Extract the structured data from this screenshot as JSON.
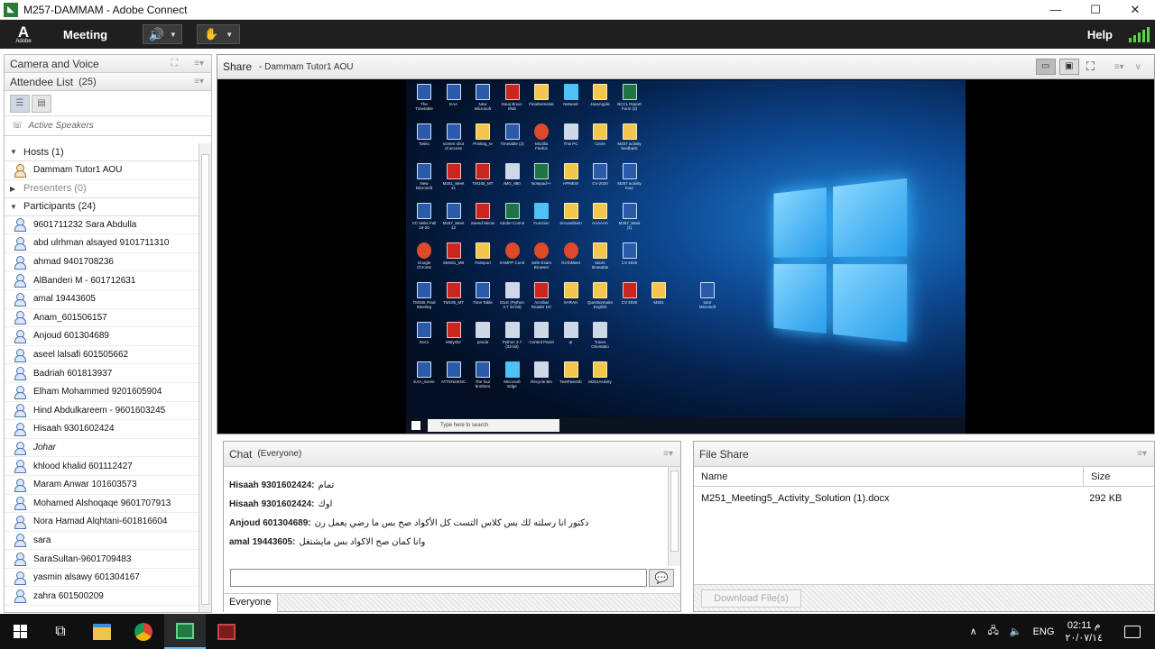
{
  "window": {
    "title": "M257-DAMMAM - Adobe Connect",
    "min": "—",
    "max": "☐",
    "close": "✕"
  },
  "menubar": {
    "meeting": "Meeting",
    "help": "Help"
  },
  "camera_pod": {
    "title": "Camera and Voice"
  },
  "attendee_pod": {
    "title": "Attendee List",
    "count": "(25)",
    "active_speakers": "Active Speakers",
    "hosts_label": "Hosts (1)",
    "hosts": [
      "Dammam Tutor1 AOU"
    ],
    "presenters_label": "Presenters (0)",
    "participants_label": "Participants (24)",
    "participants": [
      "9601711232 Sara Abdulla",
      "abd ulrhman alsayed 9101711310",
      "ahmad 9401708236",
      "AlBanderi M - 601712631",
      "amal  19443605",
      "Anam_601506157",
      "Anjoud 601304689",
      "aseel lalsafi 601505662",
      "Badriah 601813937",
      "Elham Mohammed 9201605904",
      "Hind Abdulkareem - 9601603245",
      "Hisaah 9301602424",
      "Johar",
      "khlood khalid 601112427",
      "Maram Anwar 101603573",
      "Mohamed Alshoqaqe 9601707913",
      "Nora Hamad Alqhtani-601816604",
      "sara",
      "SaraSultan-9601709483",
      "yasmin alsawy 601304167",
      "zahra 601500209"
    ]
  },
  "share_pod": {
    "title": "Share",
    "subtitle": "- Dammam Tutor1 AOU"
  },
  "desktop": {
    "search_placeholder": "Type here to search",
    "icons": [
      "The Timetable",
      "EAA",
      "New Microsoft",
      "Sauq Bnoo-Mob",
      "FinalSemeste",
      "Network",
      "JavaApplic",
      "BCCL Report Form (2)",
      "Tasks",
      "screen shot of access",
      "Printing_re",
      "Timetable (2)",
      "Mozilla Firefox",
      "This PC",
      "Circle",
      "M257 activity feedback",
      "New Microsoft",
      "M251_Meet 11",
      "TM105_MT",
      "IMG_980",
      "Notepad++",
      "HPNEW",
      "CV-2020",
      "M257 activity hour",
      "VC tasks Fall 19-20",
      "M257_Meet 12",
      "Saeed Meow",
      "Adobe Conne",
      "Function",
      "SecondSem",
      "AAAAAA",
      "M257_Meet (1)",
      "Google Chrome",
      "SM161_M8",
      "Passport",
      "XAMPP Contr",
      "Safe Exam Browser",
      "GoToMeet",
      "tutors timetable",
      "CV-2020",
      "TM155 Final Meeting",
      "TM105_MT",
      "Time Table",
      "IDLE (Python 3.7 32-bit)",
      "Acrobat Reader DC",
      "SARAH",
      "Questionnaire English",
      "CV-2020",
      "M251",
      "tutor Microsoft",
      "Doc1",
      "Malyshe",
      "panda",
      "Python 3.7 (32-bit)",
      "Control Panel",
      "qr",
      "Tutors Orientatio",
      "EAA_Scree",
      "ATTENDENC",
      "The four brothers",
      "Microsoft Edge",
      "Recycle Bin",
      "TestPassOb",
      "M251Activity"
    ]
  },
  "chat_pod": {
    "title": "Chat",
    "audience": "(Everyone)",
    "messages": [
      {
        "who": "Hisaah 9301602424:",
        "text": "تمام"
      },
      {
        "who": "Hisaah 9301602424:",
        "text": "اوك"
      },
      {
        "who": "Anjoud 601304689:",
        "text": "دكتور انا رسلته لك بس  كلاس التست كل الأكواد صح بس ما رضي يعمل رن"
      },
      {
        "who": "amal  19443605:",
        "text": "وانا كمان صح الاكواد بس مايشتغل"
      }
    ],
    "tab": "Everyone"
  },
  "file_pod": {
    "title": "File Share",
    "col_name": "Name",
    "col_size": "Size",
    "files": [
      {
        "name": "M251_Meeting5_Activity_Solution (1).docx",
        "size": "292 KB"
      }
    ],
    "download": "Download File(s)"
  },
  "os_taskbar": {
    "lang": "ENG",
    "time": "02:11 م",
    "date": "٢٠/٠٧/١٤"
  }
}
